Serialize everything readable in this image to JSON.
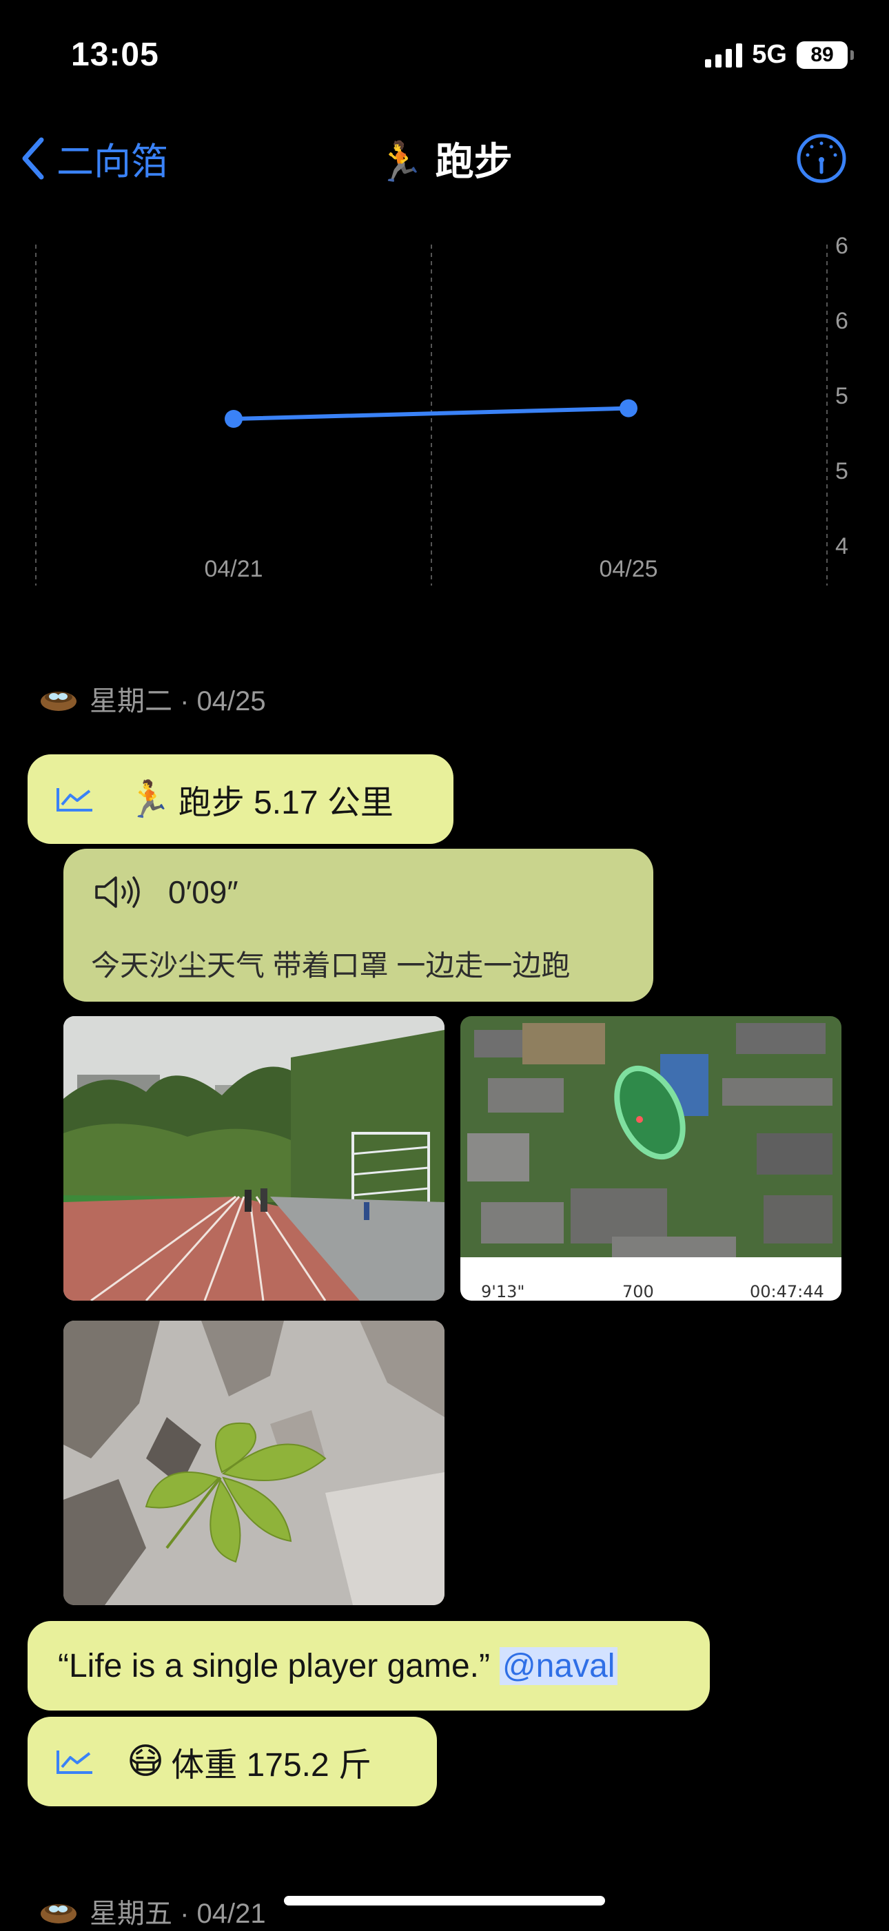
{
  "status": {
    "time": "13:05",
    "network": "5G",
    "battery": "89"
  },
  "nav": {
    "back_label": "二向箔",
    "title_emoji": "🏃",
    "title": "跑步"
  },
  "chart_data": {
    "type": "line",
    "categories": [
      "04/21",
      "04/25"
    ],
    "series": [
      {
        "values": [
          5.1,
          5.17
        ]
      }
    ],
    "y_tick_labels": [
      "6",
      "6",
      "5",
      "5",
      "4"
    ],
    "ylim": [
      4.25,
      6.25
    ],
    "grid": "vertical-dashed",
    "color": "#3a82f7"
  },
  "days": [
    {
      "label": "星期二 · 04/25",
      "run": {
        "emoji": "🏃",
        "text": "跑步 5.17 公里"
      },
      "voice": {
        "duration": "0′09″",
        "transcript": "今天沙尘天气 带着口罩 一边走一边跑"
      },
      "run_stats": {
        "pace": "9'13\"",
        "calories": "700",
        "duration": "00:47:44"
      },
      "quote": {
        "text": "“Life is a single player game.”",
        "mention": "@naval"
      },
      "weight": {
        "emoji": "😷",
        "text": "体重 175.2 斤"
      }
    },
    {
      "label": "星期五 · 04/21"
    }
  ],
  "colors": {
    "accent": "#3a82f7",
    "bubble": "#e8f09b",
    "voice_bubble": "#c9d48d"
  }
}
